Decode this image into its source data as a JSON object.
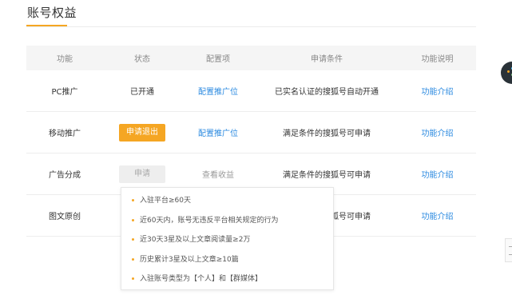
{
  "page": {
    "title": "账号权益"
  },
  "table": {
    "headers": [
      "功能",
      "状态",
      "配置项",
      "申请条件",
      "功能说明"
    ],
    "rows": [
      {
        "feature": "PC推广",
        "status": "已开通",
        "config": "配置推广位",
        "condition": "已实名认证的搜狐号自动开通",
        "intro": "功能介绍"
      },
      {
        "feature": "移动推广",
        "status_button": "申请退出",
        "config": "配置推广位",
        "condition": "满足条件的搜狐号可申请",
        "intro": "功能介绍"
      },
      {
        "feature": "广告分成",
        "status_button": "申请",
        "config": "查看收益",
        "condition": "满足条件的搜狐号可申请",
        "intro": "功能介绍"
      },
      {
        "feature": "图文原创",
        "condition": "满足条件的搜狐号可申请",
        "intro": "功能介绍"
      }
    ]
  },
  "tooltip": {
    "items": [
      "入驻平台≥60天",
      "近60天内，账号无违反平台相关规定的行为",
      "近30天3星及以上文章阅读量≥2万",
      "历史累计3星及以上文章≥10篇",
      "入驻账号类型为【个人】和【群媒体】"
    ]
  },
  "colors": {
    "accent": "#f5a623",
    "link": "#2b8ae0",
    "header_bg": "#f5f5f5"
  },
  "icons": {
    "floating": "floating-dots-icon",
    "side": "side-collapse-icon"
  }
}
